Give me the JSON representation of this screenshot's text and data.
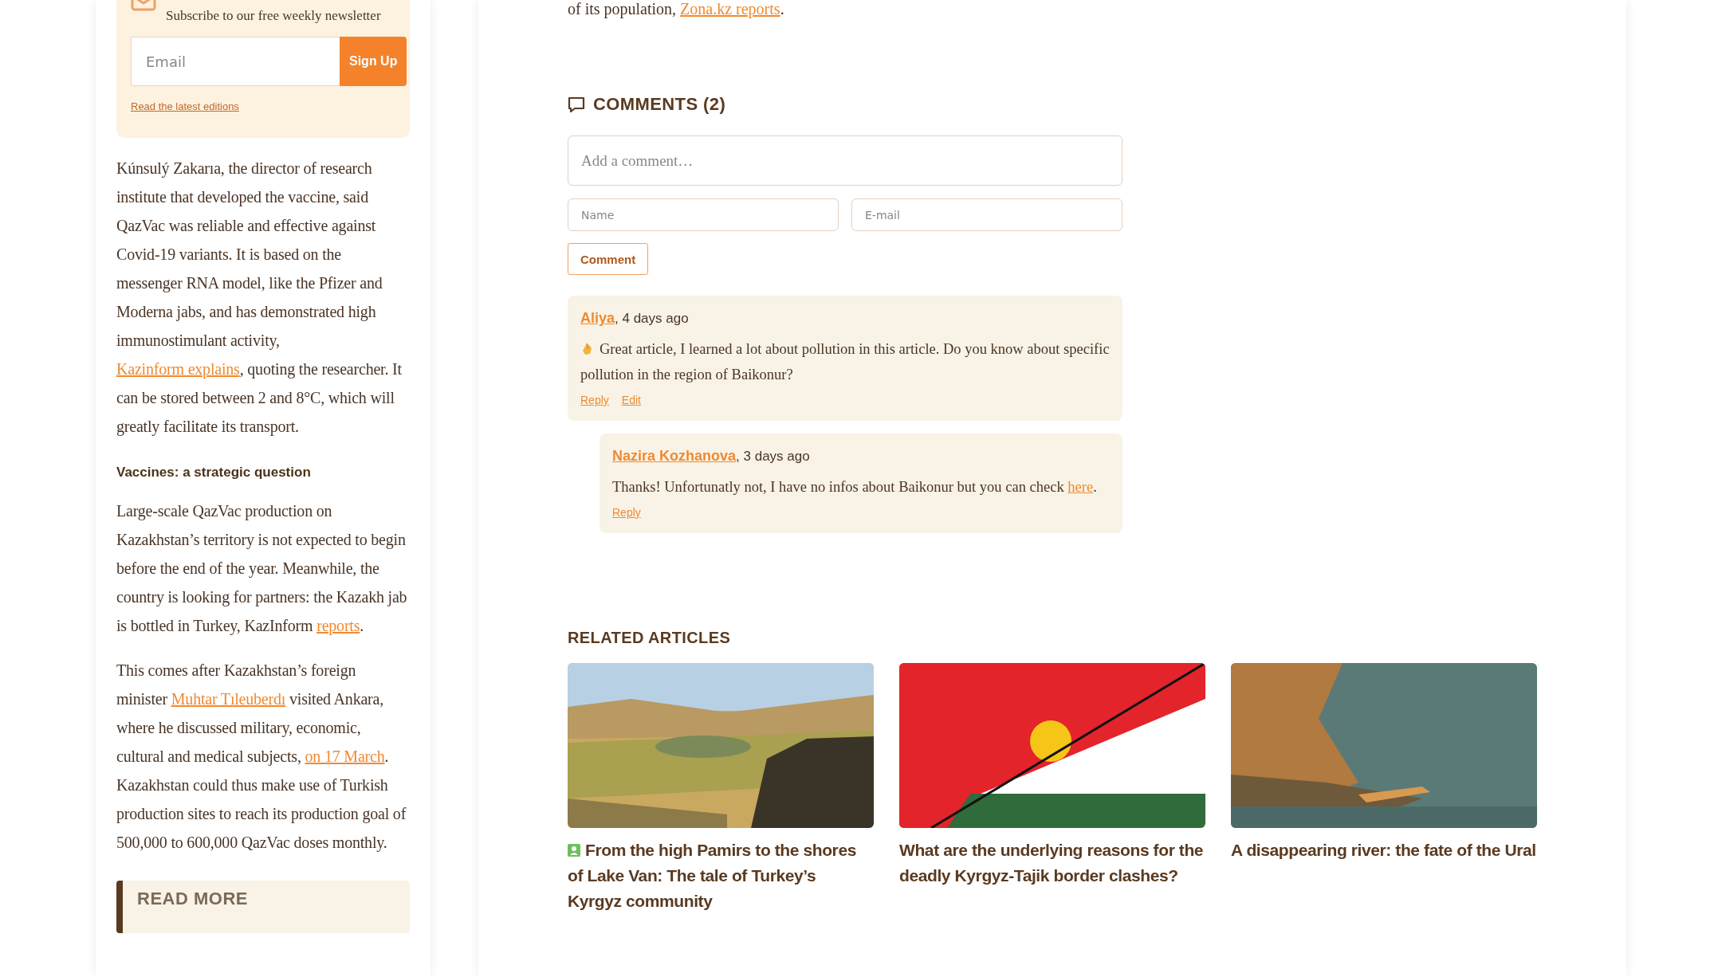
{
  "newsletter": {
    "subtitle": "Subscribe to our free weekly newsletter",
    "email_placeholder": "Email",
    "button": "Sign Up",
    "link": "Read the latest editions"
  },
  "sidebar_article": [
    {
      "kind": "paragraph",
      "parts": [
        {
          "kind": "text",
          "text": "Kúnsulý Zakarıa, the director of research institute that developed the vaccine, said QazVac was reliable and effective against Covid-19 variants. It is based on the messenger RNA model, like the Pfizer and Moderna jabs, and has demonstrated high immunostimulant activity, "
        },
        {
          "kind": "link",
          "text": "Kazinform explains"
        },
        {
          "kind": "text",
          "text": ", quoting the researcher. It can be stored between 2 and 8°C, which will greatly facilitate its transport."
        }
      ]
    },
    {
      "kind": "heading",
      "parts": [
        {
          "kind": "text",
          "text": "Vaccines: a strategic question"
        }
      ]
    },
    {
      "kind": "paragraph",
      "parts": [
        {
          "kind": "text",
          "text": "Large-scale QazVac production on Kazakhstan’s territory is not expected to begin before the end of the year. Meanwhile, the country is looking for partners: the Kazakh jab is bottled in Turkey, KazInform "
        },
        {
          "kind": "link",
          "text": "reports"
        },
        {
          "kind": "text",
          "text": "."
        }
      ]
    },
    {
      "kind": "paragraph",
      "parts": [
        {
          "kind": "text",
          "text": "This comes after Kazakhstan’s foreign minister "
        },
        {
          "kind": "link",
          "text": "Muhtar Tıleuberdı"
        },
        {
          "kind": "text",
          "text": " visited Ankara, where he discussed military, economic, cultural and medical subjects, "
        },
        {
          "kind": "link",
          "text": "on 17 March"
        },
        {
          "kind": "text",
          "text": ". Kazakhstan could thus make use of Turkish production sites to reach its production goal of 500,000 to 600,000 QazVac doses monthly."
        }
      ]
    }
  ],
  "read_more": {
    "title": "READ MORE"
  },
  "article_tail": [
    {
      "kind": "text",
      "text": "of its population, "
    },
    {
      "kind": "link",
      "text": "Zona.kz reports"
    },
    {
      "kind": "text",
      "text": "."
    }
  ],
  "comments": {
    "title": "COMMENTS (2)",
    "comment_placeholder": "Add a comment…",
    "name_placeholder": "Name",
    "email_placeholder": "E-mail",
    "submit": "Comment",
    "items": [
      {
        "author": "Aliya",
        "date": ", 4 days ago",
        "clap": true,
        "body": [
          {
            "kind": "text",
            "text": "Great article, I learned a lot about pollution in this article. Do you know about specific pollution in the region of Baikonur?"
          }
        ],
        "actions": [
          "Reply",
          "Edit"
        ],
        "children": [
          {
            "author": "Nazira Kozhanova",
            "date": ", 3 days ago",
            "clap": false,
            "body": [
              {
                "kind": "text",
                "text": "Thanks! Unfortunatly not, I have no infos about Baikonur but you can check "
              },
              {
                "kind": "link",
                "text": "here"
              },
              {
                "kind": "text",
                "text": "."
              }
            ],
            "actions": [
              "Reply"
            ]
          }
        ]
      }
    ]
  },
  "related": {
    "title": "RELATED ARTICLES",
    "articles": [
      {
        "kind": "picture",
        "title": "From the high Pamirs to the shores of Lake Van: The tale of Turkey’s Kyrgyz community",
        "tagged": true
      },
      {
        "kind": "picture",
        "title": "What are the underlying reasons for the deadly Kyrgyz-Tajik border clashes?",
        "tagged": false
      },
      {
        "kind": "picture",
        "title": "A disappearing river: the fate of the Ural",
        "tagged": false
      }
    ]
  }
}
